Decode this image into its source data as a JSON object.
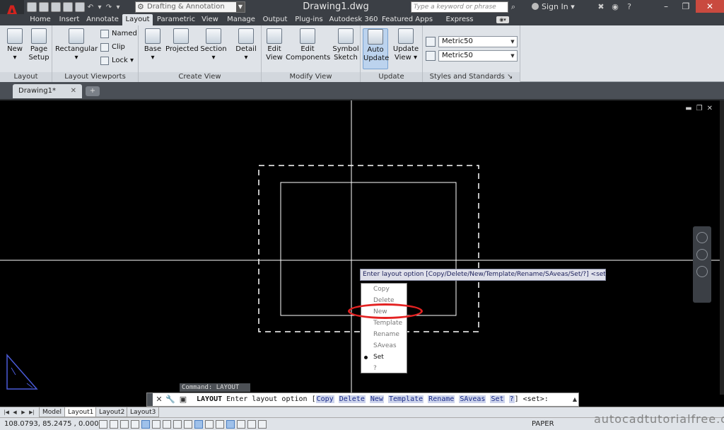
{
  "title_bar": {
    "workspace": "Drafting & Annotation",
    "document_title": "Drawing1.dwg",
    "search_placeholder": "Type a keyword or phrase",
    "sign_in": "Sign In"
  },
  "ribbon_tabs": [
    "Home",
    "Insert",
    "Annotate",
    "Layout",
    "Parametric",
    "View",
    "Manage",
    "Output",
    "Plug-ins",
    "Autodesk 360",
    "Featured Apps",
    "Express Tools"
  ],
  "active_ribbon_tab": "Layout",
  "panels": {
    "layout": {
      "title": "Layout",
      "new": "New",
      "page_setup_1": "Page",
      "page_setup_2": "Setup"
    },
    "layout_viewports": {
      "title": "Layout Viewports",
      "rectangular": "Rectangular",
      "named": "Named",
      "clip": "Clip",
      "lock": "Lock"
    },
    "create_view": {
      "title": "Create View",
      "base": "Base",
      "projected": "Projected",
      "section": "Section",
      "detail": "Detail"
    },
    "modify_view": {
      "title": "Modify View",
      "edit_view_1": "Edit",
      "edit_view_2": "View",
      "edit_components_1": "Edit",
      "edit_components_2": "Components",
      "symbol_sketch_1": "Symbol",
      "symbol_sketch_2": "Sketch"
    },
    "update": {
      "title": "Update",
      "auto_update_1": "Auto",
      "auto_update_2": "Update",
      "update_view_1": "Update",
      "update_view_2": "View"
    },
    "styles": {
      "title": "Styles and Standards",
      "combo1": "Metric50",
      "combo2": "Metric50"
    }
  },
  "file_tab": {
    "name": "Drawing1*"
  },
  "command_prompt": "Enter layout option [Copy/Delete/New/Template/Rename/SAveas/Set/?] <set>:",
  "option_menu": [
    "Copy",
    "Delete",
    "New",
    "Template",
    "Rename",
    "SAveas",
    "Set",
    "?"
  ],
  "option_menu_selected": "Set",
  "command_echo": "Command: LAYOUT",
  "command_line": {
    "command": "LAYOUT",
    "prefix": "Enter layout option [",
    "options": [
      "Copy",
      "Delete",
      "New",
      "Template",
      "Rename",
      "SAveas",
      "Set",
      "?"
    ],
    "suffix": "] <set>:"
  },
  "layout_tabs": [
    "Model",
    "Layout1",
    "Layout2",
    "Layout3"
  ],
  "active_layout_tab": "Layout1",
  "status_bar": {
    "coordinates": "108.0793, 85.2475 , 0.0000",
    "space": "PAPER"
  },
  "watermark": "autocadtutorialfree.com",
  "colors": {
    "highlight_ellipse": "#e32222",
    "brand_red": "#d2231e",
    "active_button": "#bcd3ee"
  }
}
